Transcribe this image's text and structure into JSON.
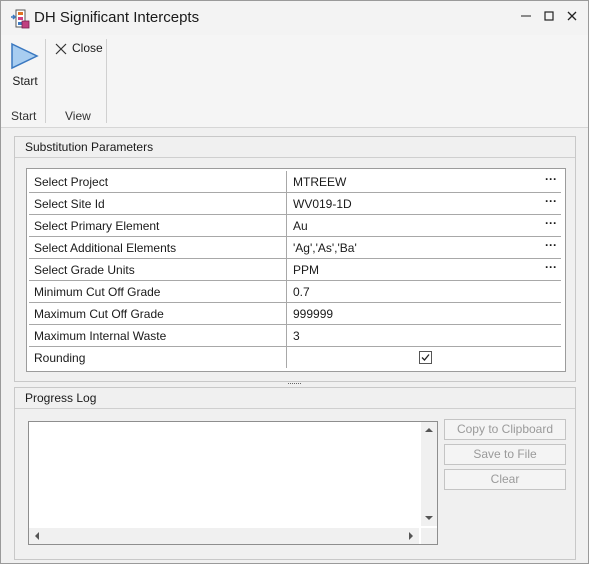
{
  "window": {
    "title": "DH Significant Intercepts",
    "minimize_glyph": "—",
    "maximize_glyph": "☐",
    "close_glyph": "✕"
  },
  "ribbon": {
    "start_label": "Start",
    "close_label": "Close",
    "group_start": "Start",
    "group_view": "View"
  },
  "substitution": {
    "header": "Substitution Parameters",
    "rows": [
      {
        "name": "Select Project",
        "value": "MTREEW",
        "has_ellipsis": true
      },
      {
        "name": "Select Site Id",
        "value": "WV019-1D",
        "has_ellipsis": true
      },
      {
        "name": "Select Primary Element",
        "value": "Au",
        "has_ellipsis": true
      },
      {
        "name": "Select Additional Elements",
        "value": "'Ag','As','Ba'",
        "has_ellipsis": true
      },
      {
        "name": "Select Grade Units",
        "value": "PPM",
        "has_ellipsis": true
      },
      {
        "name": "Minimum Cut Off Grade",
        "value": "0.7",
        "has_ellipsis": false
      },
      {
        "name": "Maximum Cut Off Grade",
        "value": "999999",
        "has_ellipsis": false
      },
      {
        "name": "Maximum Internal Waste",
        "value": "3",
        "has_ellipsis": false
      },
      {
        "name": "Rounding",
        "value": "",
        "checked": true
      }
    ],
    "ellipsis_glyph": "···"
  },
  "progress": {
    "header": "Progress Log",
    "log_text": "",
    "copy_button": "Copy to Clipboard",
    "save_button": "Save to File",
    "clear_button": "Clear"
  },
  "colors": {
    "play_fill": "#a8cdf0",
    "play_stroke": "#3a78c0",
    "disabled_text": "#9a9a9a"
  }
}
